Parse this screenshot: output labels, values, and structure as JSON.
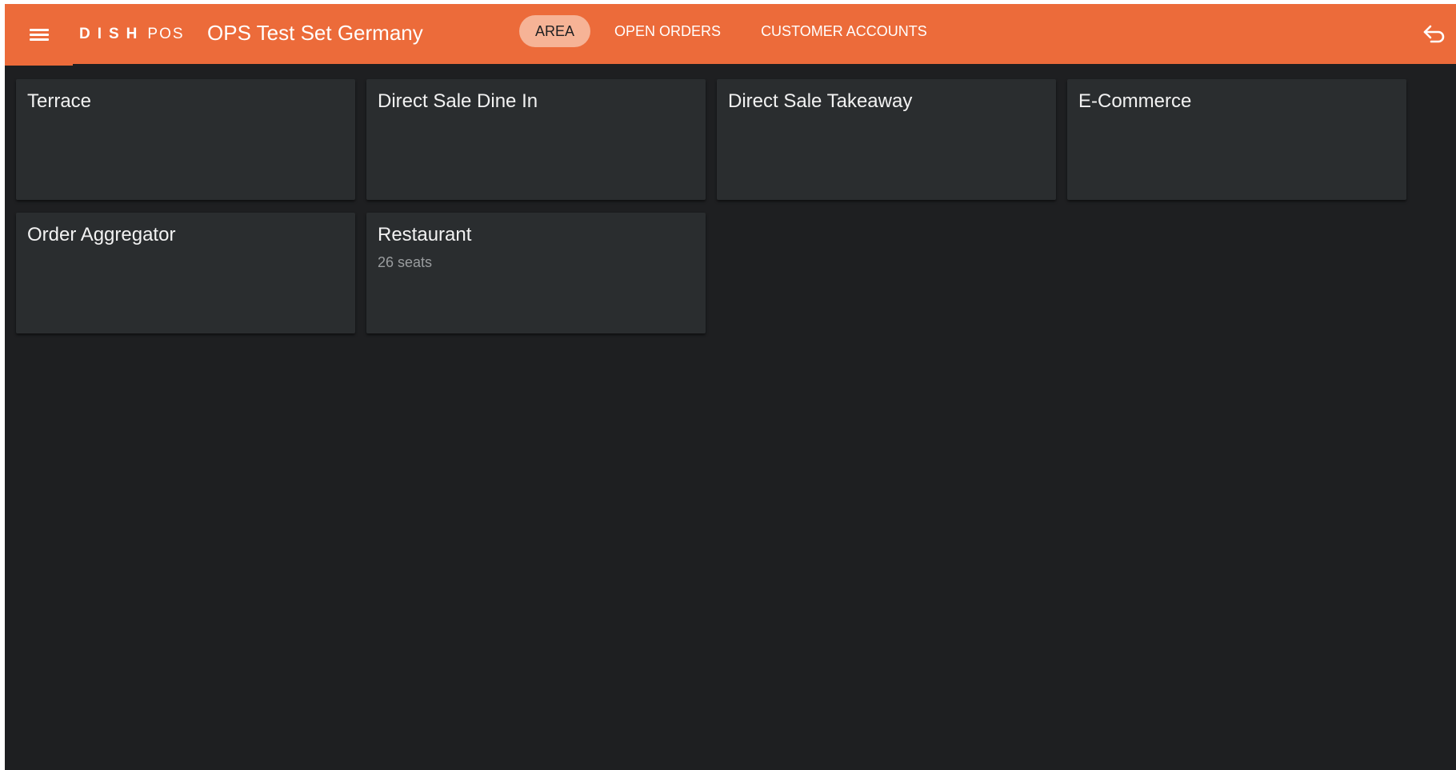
{
  "header": {
    "logo_brand": "DISH",
    "logo_product": "POS",
    "store_name": "OPS Test Set Germany",
    "tabs": [
      {
        "label": "AREA",
        "active": true
      },
      {
        "label": "OPEN ORDERS",
        "active": false
      },
      {
        "label": "CUSTOMER ACCOUNTS",
        "active": false
      }
    ]
  },
  "areas": [
    {
      "name": "Terrace",
      "subtitle": ""
    },
    {
      "name": "Direct Sale Dine In",
      "subtitle": ""
    },
    {
      "name": "Direct Sale Takeaway",
      "subtitle": ""
    },
    {
      "name": "E-Commerce",
      "subtitle": ""
    },
    {
      "name": "Order Aggregator",
      "subtitle": ""
    },
    {
      "name": "Restaurant",
      "subtitle": "26 seats"
    }
  ],
  "colors": {
    "accent": "#ec6b3a",
    "active_tab": "#f6b396",
    "background": "#1e1f21",
    "card": "#2a2d2f"
  },
  "icons": {
    "menu": "hamburger-menu-icon",
    "back": "undo-arrow-icon"
  }
}
